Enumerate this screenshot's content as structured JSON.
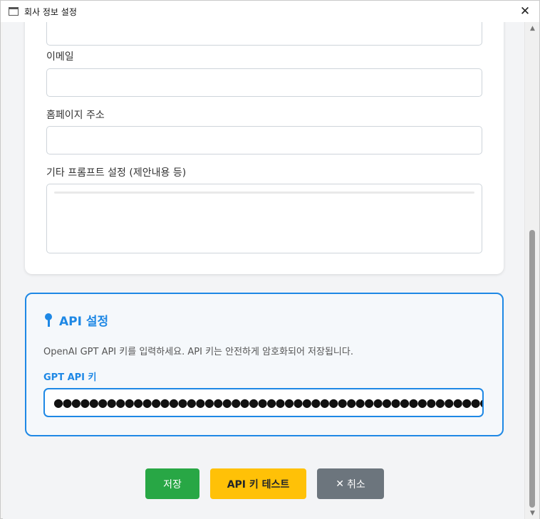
{
  "window": {
    "title": "회사 정보 설정",
    "close_glyph": "✕"
  },
  "form": {
    "email_label": "이메일",
    "email_value": "",
    "homepage_label": "홈페이지 주소",
    "homepage_value": "",
    "prompt_label": "기타 프롬프트 설정 (제안내용 등)"
  },
  "api": {
    "heading": "API 설정",
    "description": "OpenAI GPT API 키를 입력하세요. API 키는 안전하게 암호화되어 저장됩니다.",
    "key_label": "GPT API 키",
    "key_masked": "●●●●●●●●●●●●●●●●●●●●●●●●●●●●●●●●●●●●●●●●●●●●●●●●●●●●●●●●●●●●●●●●●●●"
  },
  "buttons": {
    "save": "저장",
    "test": "API 키 테스트",
    "cancel_icon": "✕",
    "cancel": "취소"
  },
  "scrollbar": {
    "up_glyph": "▲",
    "down_glyph": "▼"
  },
  "icons": {
    "app": "window-icon",
    "close": "close-icon",
    "key": "key-icon",
    "cancel": "x-icon"
  },
  "colors": {
    "accent": "#1e88e5",
    "save": "#28a745",
    "test": "#ffc107",
    "cancel": "#6c757d"
  }
}
